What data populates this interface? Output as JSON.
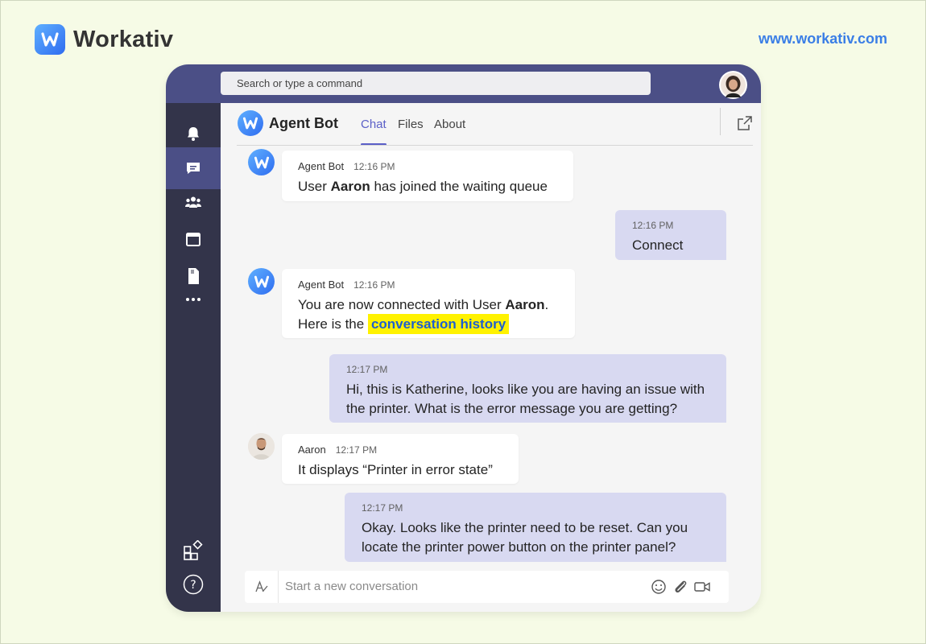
{
  "brand": {
    "name": "Workativ",
    "url": "www.workativ.com"
  },
  "search": {
    "placeholder": "Search or type a command"
  },
  "rail": [
    "bell-icon",
    "chat-icon",
    "teams-icon",
    "calendar-icon",
    "files-icon",
    "more-icon",
    "apps-icon",
    "help-icon"
  ],
  "header": {
    "bot_name": "Agent Bot",
    "tabs": [
      "Chat",
      "Files",
      "About"
    ],
    "active_tab": "Chat"
  },
  "messages": [
    {
      "sender": "Agent Bot",
      "time": "12:16 PM",
      "pre": "User ",
      "bold": "Aaron",
      "post": " has joined the waiting queue"
    },
    {
      "time": "12:16 PM",
      "text": "Connect"
    },
    {
      "sender": "Agent Bot",
      "time": "12:16 PM",
      "pre": "You are now connected with User ",
      "bold": "Aaron",
      "post": ".",
      "line2": "Here is the ",
      "highlight": "conversation history"
    },
    {
      "time": "12:17 PM",
      "line1": "Hi, this is Katherine, looks like you are having an issue with",
      "line2": "the printer. What is the error message you are getting?"
    },
    {
      "sender": "Aaron",
      "time": "12:17 PM",
      "text": "It displays “Printer  in  error  state”"
    },
    {
      "time": "12:17 PM",
      "line1": "Okay. Looks like the printer need to be reset. Can you",
      "line2": "locate the printer power button on the printer panel?"
    }
  ],
  "composer": {
    "placeholder": "Start a new conversation"
  },
  "colors": {
    "accent": "#5b5fc7",
    "topbar": "#4b4f86",
    "rail": "#33344a",
    "outgoing_bubble": "#d8d9f1",
    "highlight": "#fff200"
  }
}
